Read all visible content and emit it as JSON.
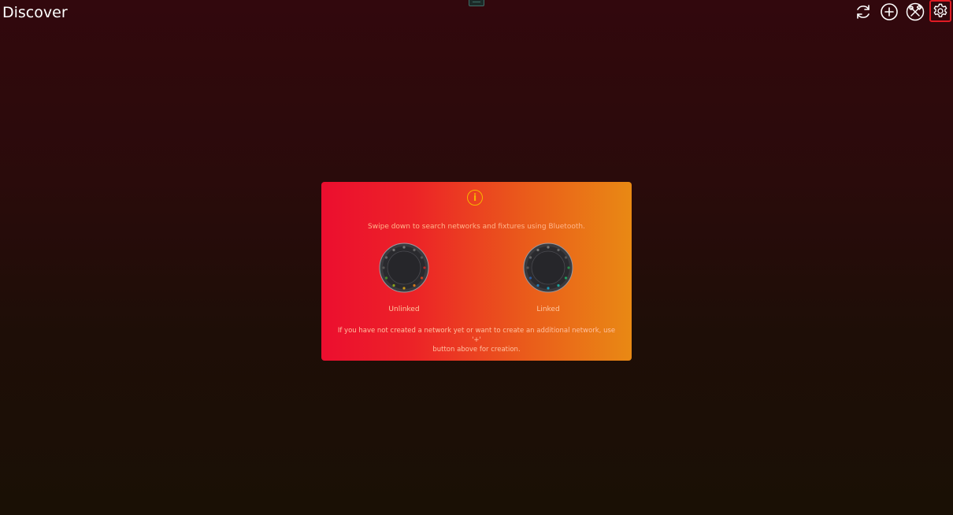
{
  "header": {
    "title": "Discover"
  },
  "toolbar": {
    "refresh_icon": "refresh-icon",
    "add_icon": "add-circle-icon",
    "tools_icon": "tools-icon",
    "settings_icon": "gear-icon",
    "settings_highlight_color": "#e01b24"
  },
  "info_card": {
    "icon": "info-icon",
    "icon_glyph": "i",
    "hint": "Swipe down to search networks and fixtures using Bluetooth.",
    "unlinked_label": "Unlinked",
    "linked_label": "Linked",
    "footnote_line1": "If you have not created a network yet or want to create an additional network, use '+'",
    "footnote_line2": "button above for creation.",
    "gradient_start": "#ec0e2f",
    "gradient_end": "#e98914"
  }
}
